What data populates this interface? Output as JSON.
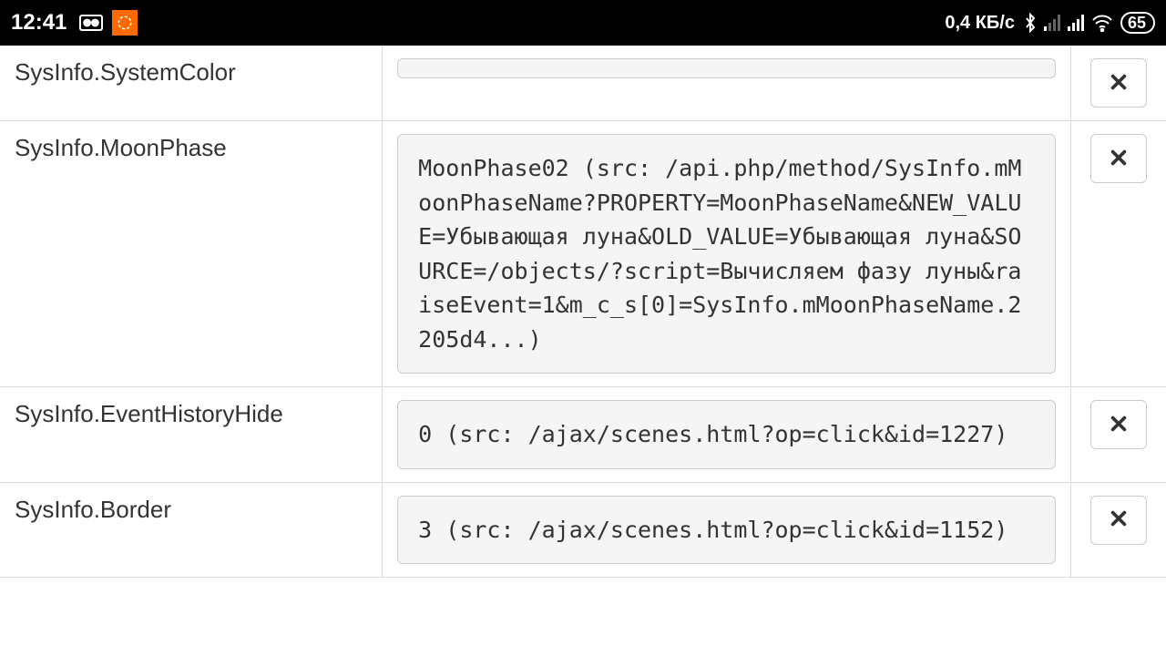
{
  "status_bar": {
    "time": "12:41",
    "speed": "0,4 КБ/с",
    "battery": "65"
  },
  "rows": [
    {
      "label": "SysInfo.SystemColor",
      "value": ""
    },
    {
      "label": "SysInfo.MoonPhase",
      "value": "MoonPhase02 (src: /api.php/method/SysInfo.mMoonPhaseName?PROPERTY=MoonPhaseName&NEW_VALUE=Убывающая луна&OLD_VALUE=Убывающая луна&SOURCE=/objects/?script=Вычисляем фазу луны&raiseEvent=1&m_c_s[0]=SysInfo.mMoonPhaseName.2205d4...)"
    },
    {
      "label": "SysInfo.EventHistoryHide",
      "value": "0 (src: /ajax/scenes.html?op=click&id=1227)"
    },
    {
      "label": "SysInfo.Border",
      "value": "3 (src: /ajax/scenes.html?op=click&id=1152)"
    }
  ]
}
